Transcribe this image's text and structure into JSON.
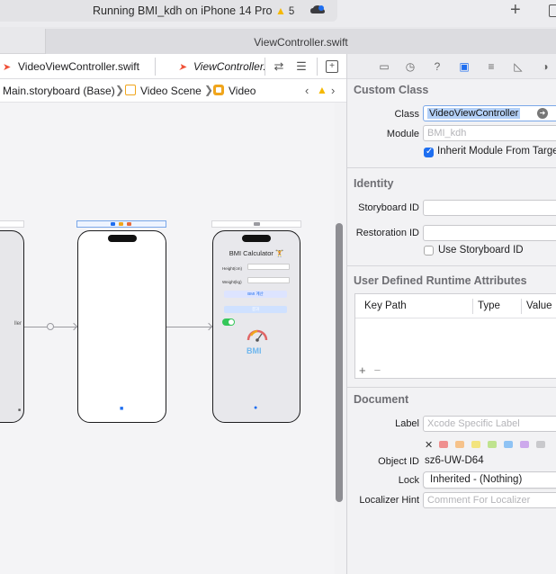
{
  "toolbar": {
    "status": "Running BMI_kdh on iPhone 14 Pro",
    "warnings": "5"
  },
  "file_tab": {
    "title": "ViewController.swift"
  },
  "editor_tabs": [
    {
      "label": "VideoViewController.swift"
    },
    {
      "label": "ViewController."
    }
  ],
  "breadcrumb": {
    "storyboard": "Main.storyboard (Base)",
    "scene": "Video Scene",
    "item": "Video"
  },
  "canvas": {
    "left_partial_text": "ller",
    "calc_title": "BMI Calculator",
    "height_label": "Height(cm)",
    "weight_label": "Weight(kg)",
    "calc_button": "BMI 계산",
    "result_button": "결과",
    "bmi_text": "BMI"
  },
  "inspector": {
    "custom_class": {
      "title": "Custom Class",
      "class_label": "Class",
      "class_value": "VideoViewController",
      "module_label": "Module",
      "module_placeholder": "BMI_kdh",
      "inherit_label": "Inherit Module From Target",
      "inherit_checked": true
    },
    "identity": {
      "title": "Identity",
      "storyboard_id_label": "Storyboard ID",
      "restoration_id_label": "Restoration ID",
      "use_storyboard_id_label": "Use Storyboard ID",
      "use_storyboard_id_checked": false
    },
    "runtime_attrs": {
      "title": "User Defined Runtime Attributes",
      "columns": [
        "Key Path",
        "Type",
        "Value"
      ]
    },
    "document": {
      "title": "Document",
      "label_label": "Label",
      "label_placeholder": "Xcode Specific Label",
      "object_id_label": "Object ID",
      "object_id_value": "sz6-UW-D64",
      "lock_label": "Lock",
      "lock_value": "Inherited - (Nothing)",
      "localizer_label": "Localizer Hint",
      "localizer_placeholder": "Comment For Localizer",
      "label_colors": [
        "#ef8f8f",
        "#f6c28a",
        "#f3e47e",
        "#bfe38e",
        "#8fc3f4",
        "#cda9ec",
        "#c9c9cc"
      ]
    }
  },
  "colors": {
    "accent": "#1e6ef0",
    "warning": "#f5b800",
    "storyboard_orange": "#f0a51c"
  }
}
